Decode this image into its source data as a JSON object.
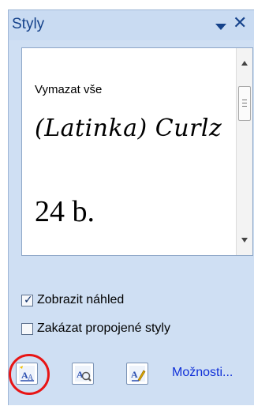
{
  "panel": {
    "title": "Styly"
  },
  "style_list": {
    "items": [
      {
        "label": "Vymazat vše"
      },
      {
        "label": "(Latinka) Curlz"
      },
      {
        "label": "24 b."
      }
    ]
  },
  "options": {
    "show_preview": {
      "label": "Zobrazit náhled",
      "checked": true
    },
    "disable_linked": {
      "label": "Zakázat propojené styly",
      "checked": false
    }
  },
  "footer": {
    "options_link": "Možnosti..."
  },
  "icons": {
    "dropdown": "triangle-down-icon",
    "close": "close-icon",
    "new_style": "new-style-icon",
    "style_inspector": "style-inspector-icon",
    "manage_styles": "manage-styles-icon"
  },
  "colors": {
    "pane_bg": "#cfdff3",
    "title_text": "#15428b",
    "link": "#1030d8",
    "highlight": "#e81414"
  }
}
